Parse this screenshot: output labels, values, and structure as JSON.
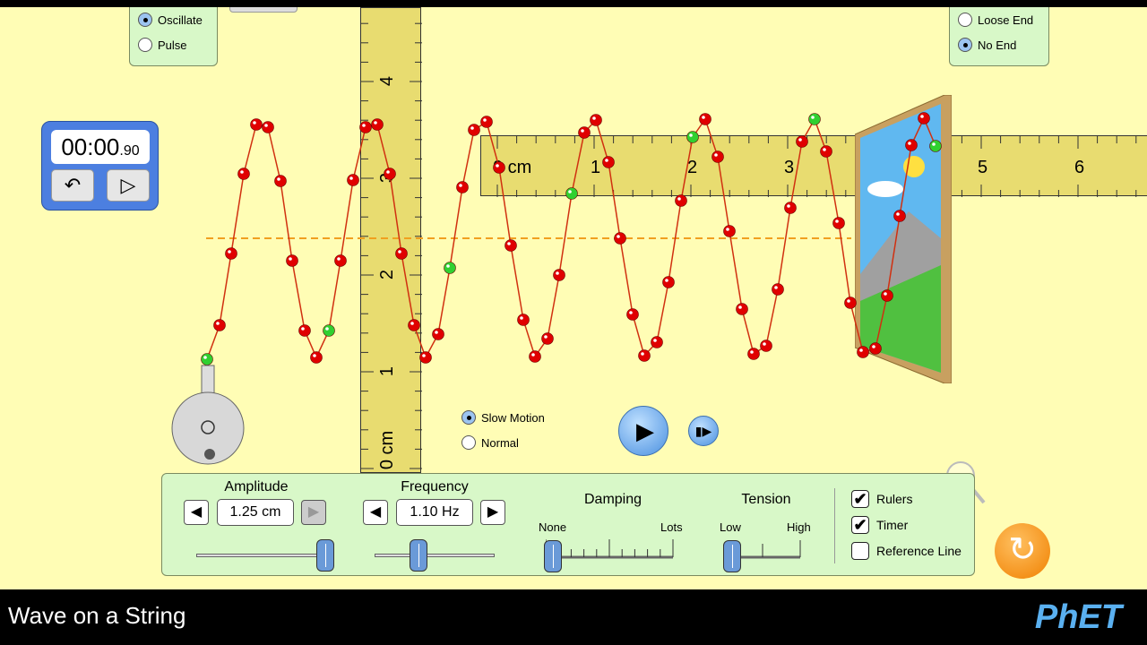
{
  "mode": {
    "options": [
      "Oscillate",
      "Pulse"
    ],
    "selected": "Oscillate"
  },
  "end": {
    "options": [
      "Loose End",
      "No End"
    ],
    "selected": "No End"
  },
  "timer": {
    "time": "00:00",
    "fraction": ".90",
    "reset_icon": "undo-icon",
    "play_icon": "play-icon"
  },
  "vertical_ruler": {
    "labels": [
      "4",
      "3",
      "2",
      "1",
      "0 cm"
    ]
  },
  "horizontal_ruler": {
    "labels": [
      "0 cm",
      "1",
      "2",
      "3",
      "4",
      "5",
      "6"
    ]
  },
  "speed": {
    "options": [
      "Slow Motion",
      "Normal"
    ],
    "selected": "Slow Motion"
  },
  "controls": {
    "amplitude": {
      "label": "Amplitude",
      "value": "1.25 cm",
      "level": 1.0
    },
    "frequency": {
      "label": "Frequency",
      "value": "1.10 Hz",
      "level": 0.4
    },
    "damping": {
      "label": "Damping",
      "min": "None",
      "max": "Lots",
      "level": 0.0
    },
    "tension": {
      "label": "Tension",
      "min": "Low",
      "max": "High",
      "level": 0.0
    },
    "checkboxes": [
      {
        "label": "Rulers",
        "checked": true
      },
      {
        "label": "Timer",
        "checked": true
      },
      {
        "label": "Reference Line",
        "checked": false
      }
    ]
  },
  "footer": {
    "title": "Wave on a String",
    "logo": "PhET"
  },
  "colors": {
    "background": "#fffdb5",
    "panel": "#d8f8c8",
    "bead": "#e00000",
    "bead_highlight": "#30d030",
    "string": "#d03010",
    "reference_line": "#f0a020"
  }
}
